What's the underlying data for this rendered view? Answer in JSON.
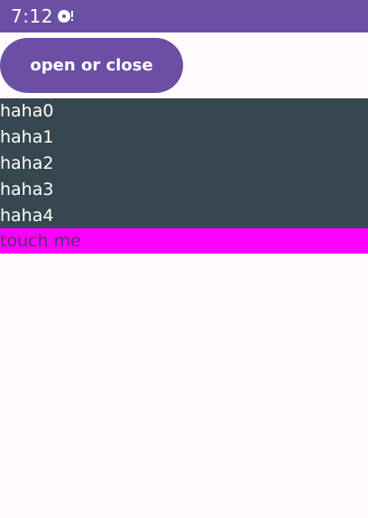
{
  "status_bar": {
    "time": "7:12",
    "icon": "media-disc-icon",
    "background": "#6a4fa4"
  },
  "toggle_button": {
    "label": "open or close",
    "background": "#6a4fa4",
    "text_color": "#ffffff"
  },
  "list": {
    "background": "#37474f",
    "items": [
      "haha0",
      "haha1",
      "haha2",
      "haha3",
      "haha4"
    ]
  },
  "touch_area": {
    "label": "touch me",
    "background": "#ff00ff"
  }
}
